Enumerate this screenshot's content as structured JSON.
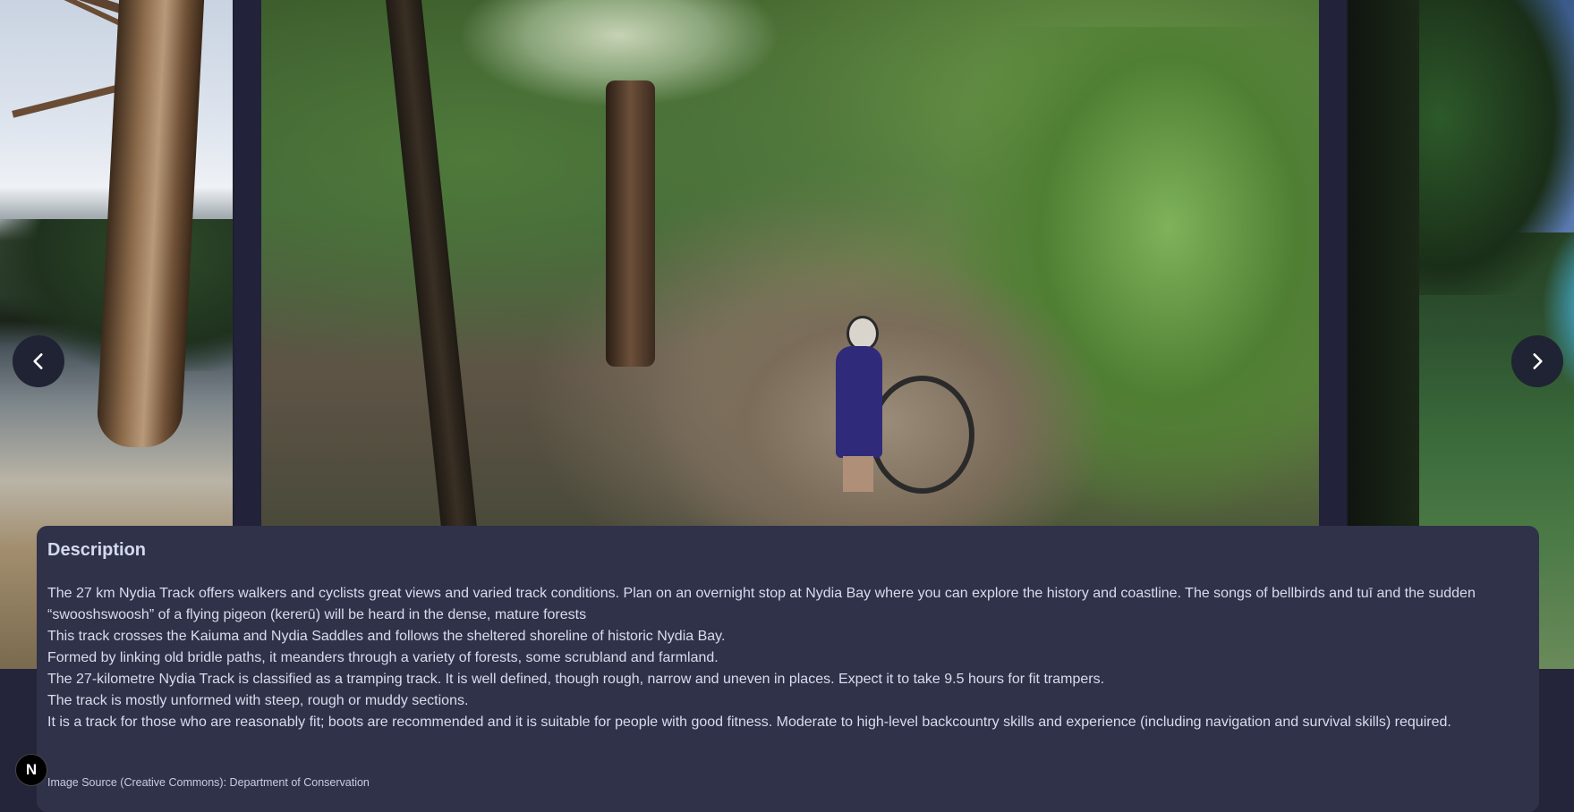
{
  "carousel": {
    "prev_icon": "chevron-left-icon",
    "next_icon": "chevron-right-icon"
  },
  "description": {
    "heading": "Description",
    "paragraphs": [
      "The 27 km Nydia Track offers walkers and cyclists great views and varied track conditions. Plan on an overnight stop at Nydia Bay where you can explore the history and coastline. The songs of bellbirds and tuī and the sudden “swooshswoosh” of a flying pigeon (kererū) will be heard in the dense, mature forests",
      "This track crosses the Kaiuma and Nydia Saddles and follows the sheltered shoreline of historic Nydia Bay.",
      "Formed by linking old bridle paths, it meanders through a variety of forests, some scrubland and farmland.",
      "The 27-kilometre Nydia Track is classified as a tramping track. It is well defined, though rough, narrow and uneven in places. Expect it to take 9.5 hours for fit trampers.",
      "The track is mostly unformed with steep, rough or muddy sections.",
      "It is a track for those who are reasonably fit; boots are recommended and it is suitable for people with good fitness. Moderate to high-level backcountry skills and experience (including navigation and survival skills) required."
    ],
    "source": "Image Source (Creative Commons): Department of Conservation"
  },
  "badge": {
    "letter": "N"
  },
  "colors": {
    "card_bg": "#30324a",
    "page_bg": "#24243a",
    "nav_button_bg": "#1f2333"
  }
}
